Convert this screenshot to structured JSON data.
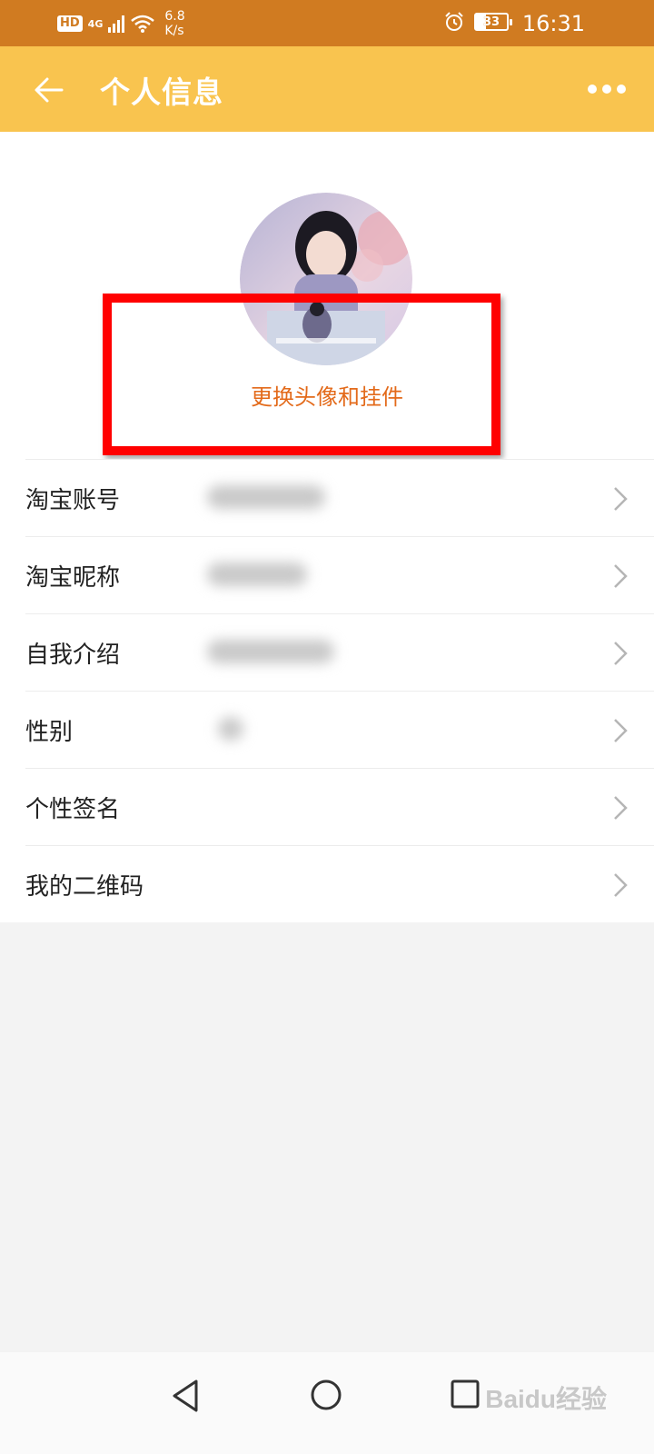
{
  "status_bar": {
    "hd": "HD",
    "network": "4G",
    "speed_value": "6.8",
    "speed_unit": "K/s",
    "battery": "33",
    "time": "16:31"
  },
  "app_bar": {
    "title": "个人信息"
  },
  "profile": {
    "change_avatar_label": "更换头像和挂件"
  },
  "list": {
    "items": [
      {
        "label": "淘宝账号"
      },
      {
        "label": "淘宝昵称"
      },
      {
        "label": "自我介绍"
      },
      {
        "label": "性别"
      },
      {
        "label": "个性签名"
      },
      {
        "label": "我的二维码"
      }
    ]
  },
  "watermark": "Baidu经验",
  "colors": {
    "status_bar": "#d07b21",
    "app_bar": "#f9c44f",
    "accent_text": "#e36a1a",
    "highlight": "#ff0000"
  }
}
